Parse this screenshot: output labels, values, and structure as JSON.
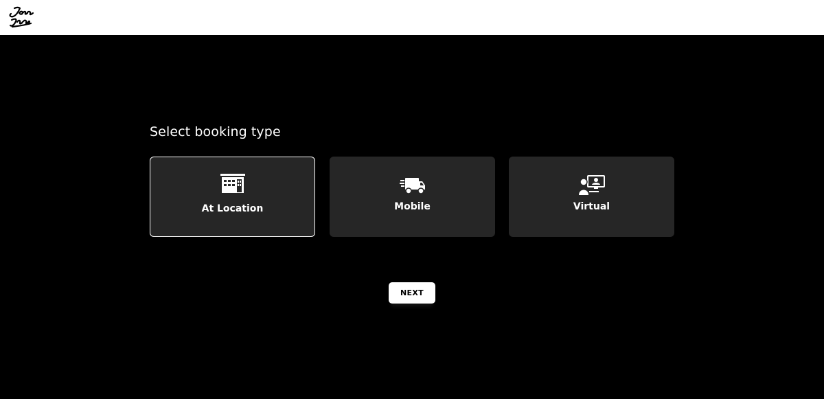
{
  "header": {
    "logo_icon": "jason-signature-logo",
    "logo_color": "#000000",
    "background": "#ffffff"
  },
  "main": {
    "background": "#000000",
    "heading": "Select booking type",
    "booking_types": [
      {
        "label": "At Location",
        "icon": "storefront-icon",
        "selected": true
      },
      {
        "label": "Mobile",
        "icon": "delivery-truck-icon",
        "selected": false
      },
      {
        "label": "Virtual",
        "icon": "video-meeting-icon",
        "selected": false
      }
    ],
    "card_background": "#262626",
    "selected_border": "#ffffff",
    "next_label": "NEXT"
  }
}
